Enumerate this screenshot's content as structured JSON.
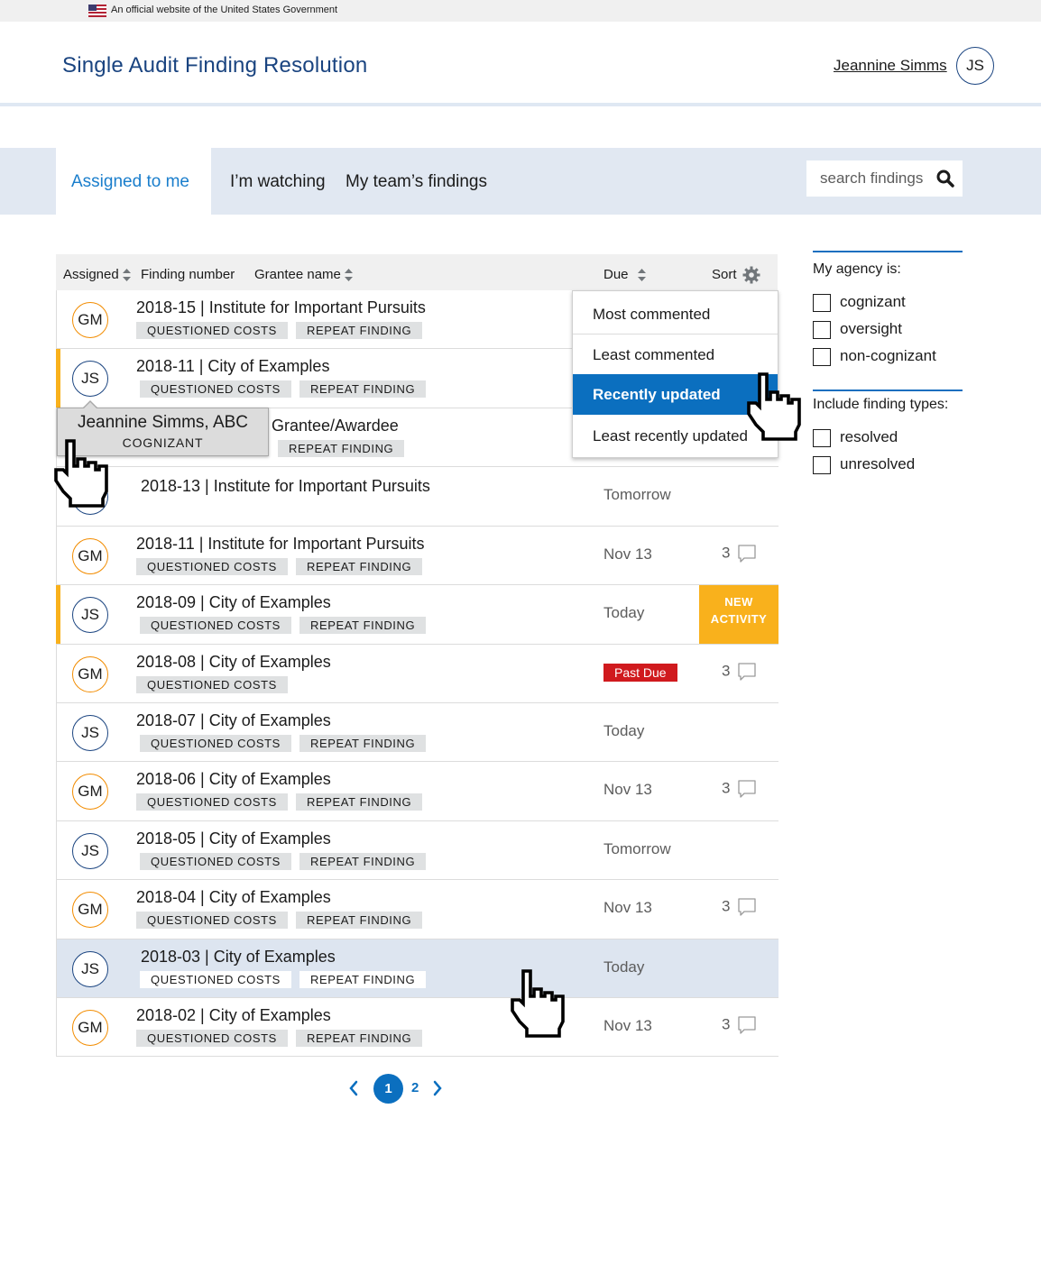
{
  "gov_banner": {
    "text": "An official website of the United States Government"
  },
  "header": {
    "site_title": "Single Audit Finding Resolution",
    "user_name": "Jeannine Simms",
    "user_initials": "JS"
  },
  "tabs": [
    {
      "label": "Assigned to me",
      "active": true
    },
    {
      "label": "I’m watching",
      "active": false
    },
    {
      "label": "My team’s findings",
      "active": false
    }
  ],
  "search": {
    "placeholder": "search findings"
  },
  "table": {
    "columns": [
      "Assigned",
      "Finding number",
      "Grantee name",
      "Due",
      "Sort"
    ],
    "rows": [
      {
        "initials": "GM",
        "title": "2018-15 | Institute for Important Pursuits",
        "tags": [
          "QUESTIONED COSTS",
          "REPEAT FINDING"
        ],
        "due": "",
        "comments": ""
      },
      {
        "initials": "JS",
        "title": "2018-11 | City of Examples",
        "tags": [
          "QUESTIONED COSTS",
          "REPEAT FINDING"
        ],
        "due": "",
        "comments": "",
        "flagged": true
      },
      {
        "initials": "",
        "title": "Grantee/Awardee",
        "tags": [
          "REPEAT FINDING"
        ],
        "due": "",
        "comments": ""
      },
      {
        "initials": "JS",
        "title": "2018-13 | Institute for Important Pursuits",
        "tags": [],
        "due": "Tomorrow",
        "comments": ""
      },
      {
        "initials": "GM",
        "title": "2018-11 |  Institute for Important Pursuits",
        "tags": [
          "QUESTIONED COSTS",
          "REPEAT FINDING"
        ],
        "due": "Nov 13",
        "comments": "3"
      },
      {
        "initials": "JS",
        "title": "2018-09 |  City of Examples",
        "tags": [
          "QUESTIONED COSTS",
          "REPEAT FINDING"
        ],
        "due": "Today",
        "comments": "",
        "flagged": true,
        "new_activity": "NEW ACTIVITY"
      },
      {
        "initials": "GM",
        "title": "2018-08 |  City of Examples",
        "tags": [
          "QUESTIONED COSTS"
        ],
        "due": "Past Due",
        "past_due": true,
        "comments": "3"
      },
      {
        "initials": "JS",
        "title": "2018-07 |  City of Examples",
        "tags": [
          "QUESTIONED COSTS",
          "REPEAT FINDING"
        ],
        "due": "Today",
        "comments": ""
      },
      {
        "initials": "GM",
        "title": "2018-06 |  City of Examples",
        "tags": [
          "QUESTIONED COSTS",
          "REPEAT FINDING"
        ],
        "due": "Nov 13",
        "comments": "3"
      },
      {
        "initials": "JS",
        "title": "2018-05 |  City of Examples",
        "tags": [
          "QUESTIONED COSTS",
          "REPEAT FINDING"
        ],
        "due": "Tomorrow",
        "comments": ""
      },
      {
        "initials": "GM",
        "title": "2018-04 |  City of Examples",
        "tags": [
          "QUESTIONED COSTS",
          "REPEAT FINDING"
        ],
        "due": "Nov 13",
        "comments": "3"
      },
      {
        "initials": "JS",
        "title": "2018-03 | City of Examples",
        "tags": [
          "QUESTIONED COSTS",
          "REPEAT FINDING"
        ],
        "due": "Today",
        "comments": "",
        "hovered": true
      },
      {
        "initials": "GM",
        "title": "2018-02 |  City of Examples",
        "tags": [
          "QUESTIONED COSTS",
          "REPEAT FINDING"
        ],
        "due": "Nov 13",
        "comments": "3"
      }
    ]
  },
  "sort_menu": {
    "items": [
      "Most commented",
      "Least commented",
      "Recently updated",
      "Least recently updated"
    ],
    "selected": "Recently updated"
  },
  "tooltip": {
    "name": "Jeannine Simms, ABC",
    "role": "COGNIZANT"
  },
  "pagination": {
    "current": "1",
    "next_page": "2"
  },
  "filters": {
    "agency_heading": "My agency is:",
    "agency_options": [
      "cognizant",
      "oversight",
      "non-cognizant"
    ],
    "types_heading": "Include finding types:",
    "type_options": [
      "resolved",
      "unresolved"
    ]
  },
  "colors": {
    "brand_blue": "#1a4480",
    "link_blue": "#0b6fbf",
    "activity_yellow": "#f9b11c",
    "past_due_red": "#d01a1e",
    "gm_orange": "#f28c00"
  }
}
